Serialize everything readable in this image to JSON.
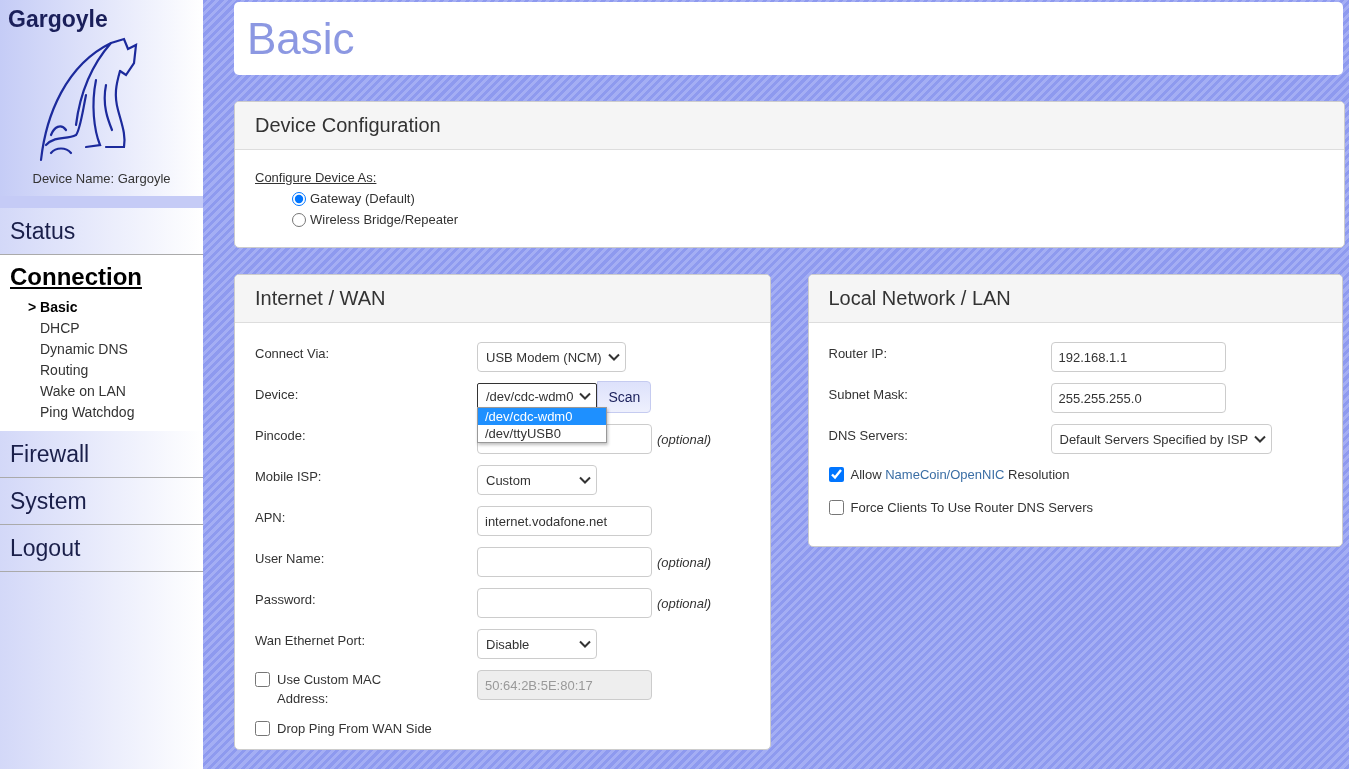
{
  "brand": {
    "title": "Gargoyle",
    "device_name": "Device Name: Gargoyle"
  },
  "sidebar": {
    "marker": ">",
    "items": [
      {
        "label": "Status",
        "selected": false
      },
      {
        "label": "Connection",
        "selected": true,
        "children": [
          {
            "label": "Basic",
            "selected": true
          },
          {
            "label": "DHCP",
            "selected": false
          },
          {
            "label": "Dynamic DNS",
            "selected": false
          },
          {
            "label": "Routing",
            "selected": false
          },
          {
            "label": "Wake on LAN",
            "selected": false
          },
          {
            "label": "Ping Watchdog",
            "selected": false
          }
        ]
      },
      {
        "label": "Firewall",
        "selected": false
      },
      {
        "label": "System",
        "selected": false
      },
      {
        "label": "Logout",
        "selected": false
      }
    ]
  },
  "page_title": "Basic",
  "device_configuration": {
    "title": "Device Configuration",
    "prompt": "Configure Device As:",
    "options": [
      {
        "label": "Gateway (Default)",
        "selected": true
      },
      {
        "label": "Wireless Bridge/Repeater",
        "selected": false
      }
    ]
  },
  "wan": {
    "title": "Internet / WAN",
    "rows": [
      {
        "kind": "select",
        "label": "Connect Via:",
        "value": "USB Modem (NCM)"
      },
      {
        "kind": "device",
        "label": "Device:",
        "value": "/dev/cdc-wdm0",
        "button": "Scan",
        "options": [
          {
            "label": "/dev/cdc-wdm0",
            "selected": true
          },
          {
            "label": "/dev/ttyUSB0",
            "selected": false
          }
        ]
      },
      {
        "kind": "text",
        "label": "Pincode:",
        "note": "(optional)"
      },
      {
        "kind": "select",
        "label": "Mobile ISP:",
        "value": "Custom"
      },
      {
        "kind": "text",
        "label": "APN:",
        "value": "internet.vodafone.net"
      },
      {
        "kind": "text",
        "label": "User Name:",
        "note": "(optional)"
      },
      {
        "kind": "text",
        "label": "Password:",
        "note": "(optional)"
      },
      {
        "kind": "select",
        "label": "Wan Ethernet Port:",
        "value": "Disable"
      },
      {
        "kind": "checkfield",
        "label": "Use Custom MAC Address:",
        "checked": false,
        "value": "50:64:2B:5E:80:17",
        "disabled": true
      },
      {
        "kind": "check",
        "label": "Drop Ping From WAN Side",
        "checked": false
      }
    ]
  },
  "lan": {
    "title": "Local Network / LAN",
    "rows": [
      {
        "kind": "text",
        "label": "Router IP:",
        "value": "192.168.1.1"
      },
      {
        "kind": "text",
        "label": "Subnet Mask:",
        "value": "255.255.255.0"
      },
      {
        "kind": "select",
        "label": "DNS Servers:",
        "value": "Default Servers Specified by ISP"
      },
      {
        "kind": "check",
        "label": "Allow",
        "link": "NameCoin/OpenNIC",
        "label_after": "Resolution",
        "checked": true
      },
      {
        "kind": "check",
        "label": "Force Clients To Use Router DNS Servers",
        "checked": false
      }
    ]
  }
}
